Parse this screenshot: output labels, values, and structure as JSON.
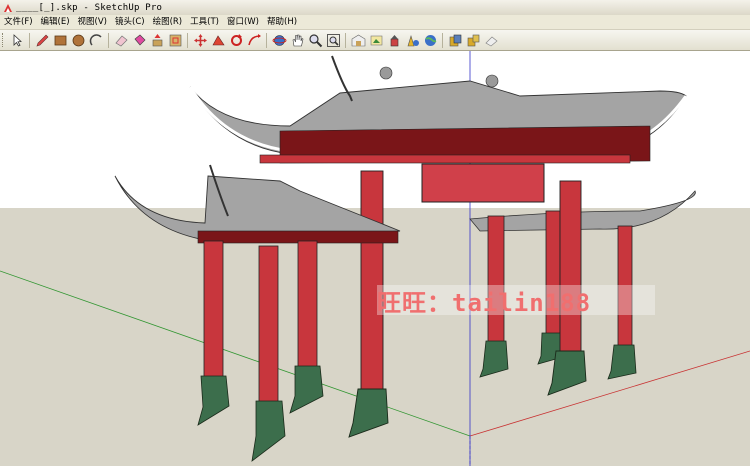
{
  "window": {
    "title": "____[_].skp - SketchUp Pro"
  },
  "menu": [
    "文件(F)",
    "编辑(E)",
    "视图(V)",
    "镜头(C)",
    "绘图(R)",
    "工具(T)",
    "窗口(W)",
    "帮助(H)"
  ],
  "toolbar": {
    "groups": [
      [
        "select-icon"
      ],
      [
        "pencil-icon",
        "rectangle-icon",
        "circle-icon",
        "arc-icon"
      ],
      [
        "eraser-icon",
        "paint-bucket-icon",
        "push-pull-icon",
        "offset-icon"
      ],
      [
        "move-icon",
        "follow-me-icon",
        "rotate-icon",
        "scale-icon"
      ],
      [
        "orbit-icon",
        "pan-icon",
        "zoom-icon",
        "zoom-extents-icon"
      ],
      [
        "warehouse-icon",
        "share-model-icon",
        "component-icon",
        "extension-icon",
        "google-earth-icon"
      ],
      [
        "send-layout-icon",
        "export-icon",
        "preview-icon"
      ]
    ]
  },
  "watermark": {
    "text": "旺旺：tailin188"
  },
  "colors": {
    "sky": "#ffffff",
    "ground": "#d8d5c8",
    "column_red": "#c8363d",
    "base_green": "#3c6e4c",
    "roof_tile": "#a4a4a4",
    "axis_red": "#c83232",
    "axis_green": "#329632",
    "axis_blue": "#3232c8"
  }
}
